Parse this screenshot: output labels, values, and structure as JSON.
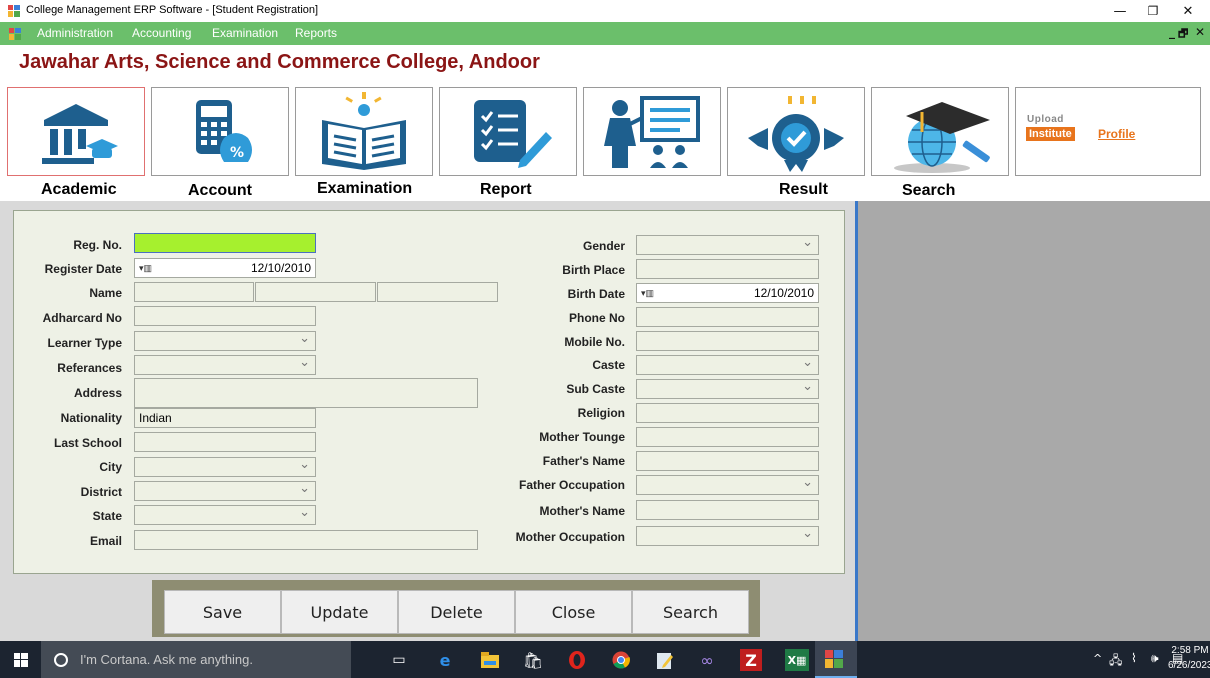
{
  "window": {
    "title": "College Management ERP  Software - [Student Registration]",
    "controls": {
      "minimize": "—",
      "restore": "❐",
      "close": "✕"
    }
  },
  "menu": {
    "items": [
      "Administration",
      "Accounting",
      "Examination",
      "Reports"
    ],
    "mdi_controls": {
      "minimize": "_",
      "restore": "🗗",
      "close": "✕"
    }
  },
  "college_name": "Jawahar Arts, Science and Commerce College, Andoor",
  "tiles": [
    {
      "label": "Academic",
      "icon": "bank-building-icon"
    },
    {
      "label": "Account",
      "icon": "calculator-money-bag-icon"
    },
    {
      "label": "Examination",
      "icon": "open-book-icon"
    },
    {
      "label": "Report",
      "icon": "checklist-clipboard-icon"
    },
    {
      "label": "",
      "icon": "teacher-presentation-icon"
    },
    {
      "label": "Result",
      "icon": "award-ribbon-icon"
    },
    {
      "label": "Search",
      "icon": "graduation-cap-globe-icon"
    }
  ],
  "upload_profile": {
    "small": "Upload",
    "highlight": "Institute",
    "link": "Profile"
  },
  "form": {
    "left": {
      "reg_no": {
        "label": "Reg. No.",
        "value": ""
      },
      "register_date": {
        "label": "Register Date",
        "value": "12/10/2010"
      },
      "name": {
        "label": "Name",
        "first": "",
        "middle": "",
        "last": ""
      },
      "adharcard": {
        "label": "Adharcard No",
        "value": ""
      },
      "learner_type": {
        "label": "Learner Type",
        "value": ""
      },
      "references": {
        "label": "Referances",
        "value": ""
      },
      "address": {
        "label": "Address",
        "value": ""
      },
      "nationality": {
        "label": "Nationality",
        "value": "Indian"
      },
      "last_school": {
        "label": "Last School",
        "value": ""
      },
      "city": {
        "label": "City",
        "value": ""
      },
      "district": {
        "label": "District",
        "value": ""
      },
      "state": {
        "label": "State",
        "value": ""
      },
      "email": {
        "label": "Email",
        "value": ""
      }
    },
    "right": {
      "gender": {
        "label": "Gender",
        "value": ""
      },
      "birth_place": {
        "label": "Birth Place",
        "value": ""
      },
      "birth_date": {
        "label": "Birth Date",
        "value": "12/10/2010"
      },
      "phone_no": {
        "label": "Phone No",
        "value": ""
      },
      "mobile_no": {
        "label": "Mobile No.",
        "value": ""
      },
      "caste": {
        "label": "Caste",
        "value": ""
      },
      "sub_caste": {
        "label": "Sub Caste",
        "value": ""
      },
      "religion": {
        "label": "Religion",
        "value": ""
      },
      "mother_tounge": {
        "label": "Mother Tounge",
        "value": ""
      },
      "fathers_name": {
        "label": "Father's Name",
        "value": ""
      },
      "father_occupation": {
        "label": "Father Occupation",
        "value": ""
      },
      "mothers_name": {
        "label": "Mother's Name",
        "value": ""
      },
      "mother_occupation": {
        "label": "Mother Occupation",
        "value": ""
      }
    }
  },
  "actions": [
    "Save",
    "Update",
    "Delete",
    "Close",
    "Search"
  ],
  "taskbar": {
    "search_placeholder": "I'm Cortana. Ask me anything.",
    "apps": [
      "task-view-icon",
      "edge-icon",
      "file-explorer-icon",
      "store-icon",
      "opera-icon",
      "chrome-icon",
      "notepad-icon",
      "link-icon",
      "filezilla-icon",
      "excel-icon",
      "erp-app-icon"
    ],
    "time": "2:58 PM",
    "date": "6/26/2023"
  }
}
